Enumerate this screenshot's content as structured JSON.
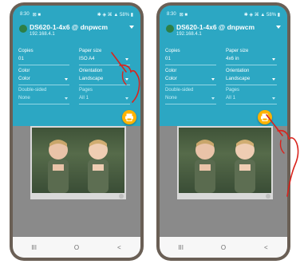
{
  "screens": [
    {
      "status": {
        "time": "8:30",
        "left_icons": "⊠ ■",
        "right_icons": "✱ ◈ ⌘ ▲ 58% ▮"
      },
      "printer": {
        "name": "DS620-1-4x6 @ dnpwcm",
        "ip": "192.168.4.1"
      },
      "fields": {
        "copies": {
          "label": "Copies",
          "value": "01"
        },
        "paper_size": {
          "label": "Paper size",
          "value": "ISO A4"
        },
        "color": {
          "label": "Color",
          "value": "Color"
        },
        "orientation": {
          "label": "Orientation",
          "value": "Landscape"
        },
        "double_sided": {
          "label": "Double-sided",
          "value": "None"
        },
        "pages": {
          "label": "Pages",
          "value": "All 1"
        }
      },
      "nav": {
        "recent": "III",
        "home": "O",
        "back": "<"
      }
    },
    {
      "status": {
        "time": "8:30",
        "left_icons": "⊠ ■",
        "right_icons": "✱ ◈ ⌘ ▲ 58% ▮"
      },
      "printer": {
        "name": "DS620-1-4x6 @ dnpwcm",
        "ip": "192.168.4.1"
      },
      "fields": {
        "copies": {
          "label": "Copies",
          "value": "01"
        },
        "paper_size": {
          "label": "Paper size",
          "value": "4x6 in"
        },
        "color": {
          "label": "Color",
          "value": "Color"
        },
        "orientation": {
          "label": "Orientation",
          "value": "Landscape"
        },
        "double_sided": {
          "label": "Double-sided",
          "value": "None"
        },
        "pages": {
          "label": "Pages",
          "value": "All 1"
        }
      },
      "nav": {
        "recent": "III",
        "home": "O",
        "back": "<"
      }
    }
  ],
  "colors": {
    "header": "#2ca7c3",
    "fab": "#ffb300",
    "annotation": "#d9231c"
  }
}
